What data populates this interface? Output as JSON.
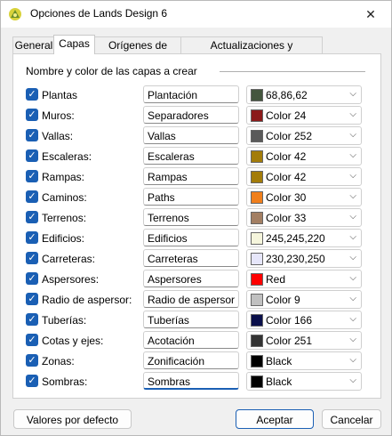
{
  "window": {
    "title": "Opciones de Lands Design 6",
    "close_label": "✕"
  },
  "tabs": [
    {
      "label": "General"
    },
    {
      "label": "Capas"
    },
    {
      "label": "Orígenes de datos"
    },
    {
      "label": "Actualizaciones y estadísticas"
    }
  ],
  "group": {
    "label": "Nombre y color de las capas a crear"
  },
  "layers": [
    {
      "label": "Plantas",
      "name": "Plantación",
      "color_text": "68,86,62",
      "swatch": "#44563e"
    },
    {
      "label": "Muros:",
      "name": "Separadores",
      "color_text": "Color 24",
      "swatch": "#8b1a1a"
    },
    {
      "label": "Vallas:",
      "name": "Vallas",
      "color_text": "Color 252",
      "swatch": "#5a5a5a"
    },
    {
      "label": "Escaleras:",
      "name": "Escaleras",
      "color_text": "Color 42",
      "swatch": "#a37c0a"
    },
    {
      "label": "Rampas:",
      "name": "Rampas",
      "color_text": "Color 42",
      "swatch": "#a37c0a"
    },
    {
      "label": "Caminos:",
      "name": "Paths",
      "color_text": "Color 30",
      "swatch": "#f07f1c"
    },
    {
      "label": "Terrenos:",
      "name": "Terrenos",
      "color_text": "Color 33",
      "swatch": "#a37f63"
    },
    {
      "label": "Edificios:",
      "name": "Edificios",
      "color_text": "245,245,220",
      "swatch": "#f5f5dc"
    },
    {
      "label": "Carreteras:",
      "name": "Carreteras",
      "color_text": "230,230,250",
      "swatch": "#e6e6fa"
    },
    {
      "label": "Aspersores:",
      "name": "Aspersores",
      "color_text": "Red",
      "swatch": "#ff0000"
    },
    {
      "label": "Radio de aspersor:",
      "name": "Radio de aspersor",
      "color_text": "Color 9",
      "swatch": "#c0c0c0"
    },
    {
      "label": "Tuberías:",
      "name": "Tuberías",
      "color_text": "Color 166",
      "swatch": "#0a0f4a"
    },
    {
      "label": "Cotas y ejes:",
      "name": "Acotación",
      "color_text": "Color 251",
      "swatch": "#333333"
    },
    {
      "label": "Zonas:",
      "name": "Zonificación",
      "color_text": "Black",
      "swatch": "#000000"
    },
    {
      "label": "Sombras:",
      "name": "Sombras",
      "color_text": "Black",
      "swatch": "#000000"
    }
  ],
  "buttons": {
    "defaults": "Valores por defecto",
    "accept": "Aceptar",
    "cancel": "Cancelar"
  },
  "colors": {
    "accent": "#1a5fb4"
  }
}
